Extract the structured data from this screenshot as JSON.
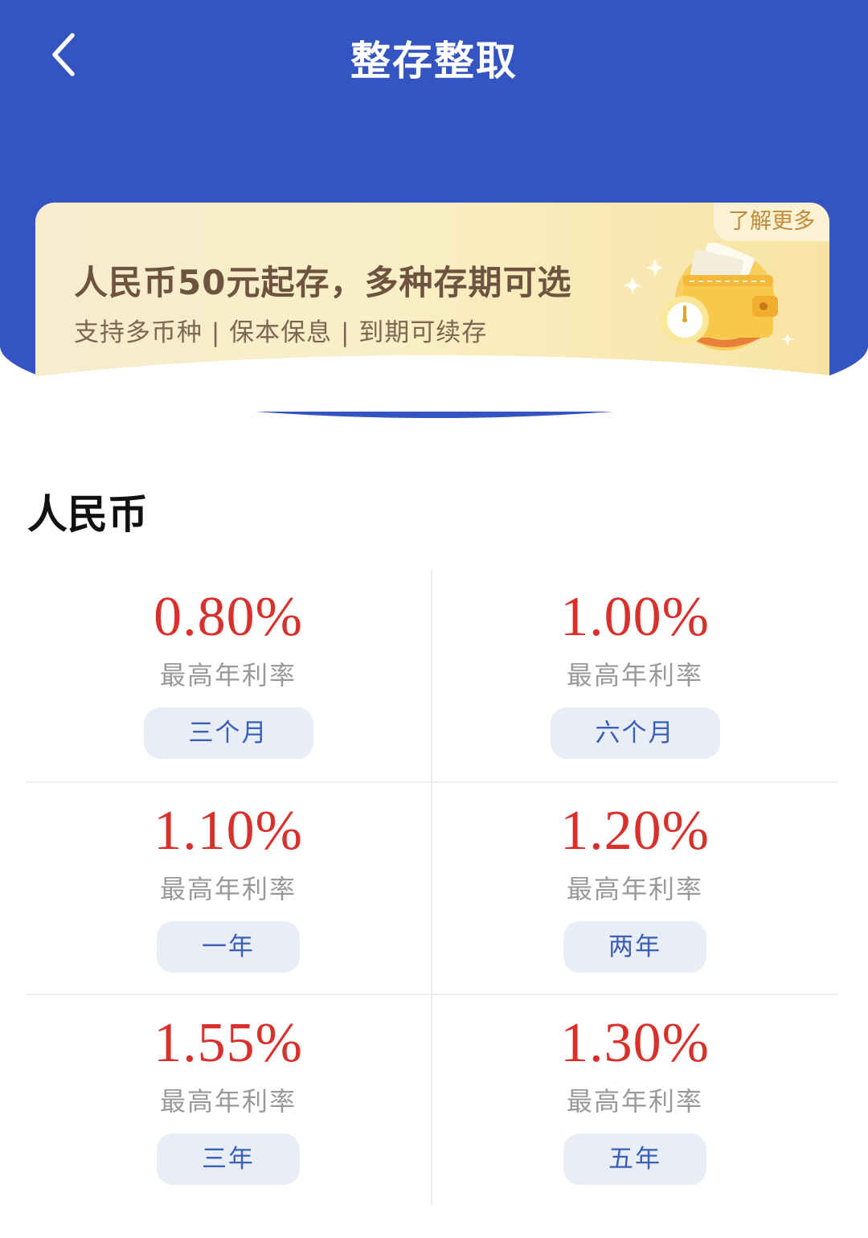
{
  "header": {
    "title": "整存整取",
    "back_icon": "chevron-left-icon",
    "background": "#3354c1"
  },
  "banner": {
    "learn_more": "了解更多",
    "headline": "人民币50元起存，多种存期可选",
    "subline": "支持多币种 | 保本保息 | 到期可续存",
    "illustration": "wallet-clock-illustration"
  },
  "section": {
    "title": "人民币"
  },
  "rates": [
    {
      "rate": "0.80%",
      "label": "最高年利率",
      "term": "三个月"
    },
    {
      "rate": "1.00%",
      "label": "最高年利率",
      "term": "六个月"
    },
    {
      "rate": "1.10%",
      "label": "最高年利率",
      "term": "一年"
    },
    {
      "rate": "1.20%",
      "label": "最高年利率",
      "term": "两年"
    },
    {
      "rate": "1.55%",
      "label": "最高年利率",
      "term": "三年"
    },
    {
      "rate": "1.30%",
      "label": "最高年利率",
      "term": "五年"
    }
  ],
  "colors": {
    "rate": "#d9302c",
    "term_button_bg": "#e9edf7",
    "term_button_text": "#3a5fb8"
  }
}
